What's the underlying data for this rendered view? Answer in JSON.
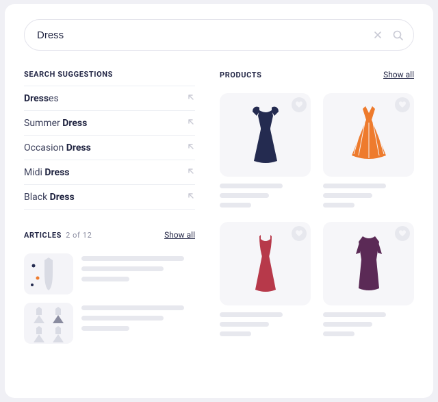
{
  "search": {
    "value": "Dress",
    "placeholder": ""
  },
  "sections": {
    "suggestions_title": "SEARCH SUGGESTIONS",
    "products_title": "PRODUCTS",
    "articles_title": "ARTICLES",
    "show_all_label": "Show all",
    "articles_count": "2 of 12"
  },
  "suggestions": [
    {
      "prefix": "Dress",
      "suffix": "es",
      "bold_first": true
    },
    {
      "prefix": "Summer ",
      "suffix": "Dress",
      "bold_first": false
    },
    {
      "prefix": "Occasion ",
      "suffix": "Dress",
      "bold_first": false
    },
    {
      "prefix": "Midi ",
      "suffix": "Dress",
      "bold_first": false
    },
    {
      "prefix": "Black ",
      "suffix": "Dress",
      "bold_first": false
    }
  ],
  "products": [
    {
      "name": "navy-dress",
      "color": "#242b50",
      "style": "capsleeve"
    },
    {
      "name": "orange-dress",
      "color": "#ee7b2d",
      "style": "flare"
    },
    {
      "name": "red-dress",
      "color": "#b7394a",
      "style": "slip"
    },
    {
      "name": "plum-dress",
      "color": "#5b2a56",
      "style": "sheath"
    }
  ],
  "articles": [
    {
      "name": "article-1"
    },
    {
      "name": "article-2"
    }
  ],
  "icons": {
    "clear": "x-icon",
    "search": "search-icon",
    "arrow": "arrow-nw-icon",
    "heart": "heart-icon"
  }
}
